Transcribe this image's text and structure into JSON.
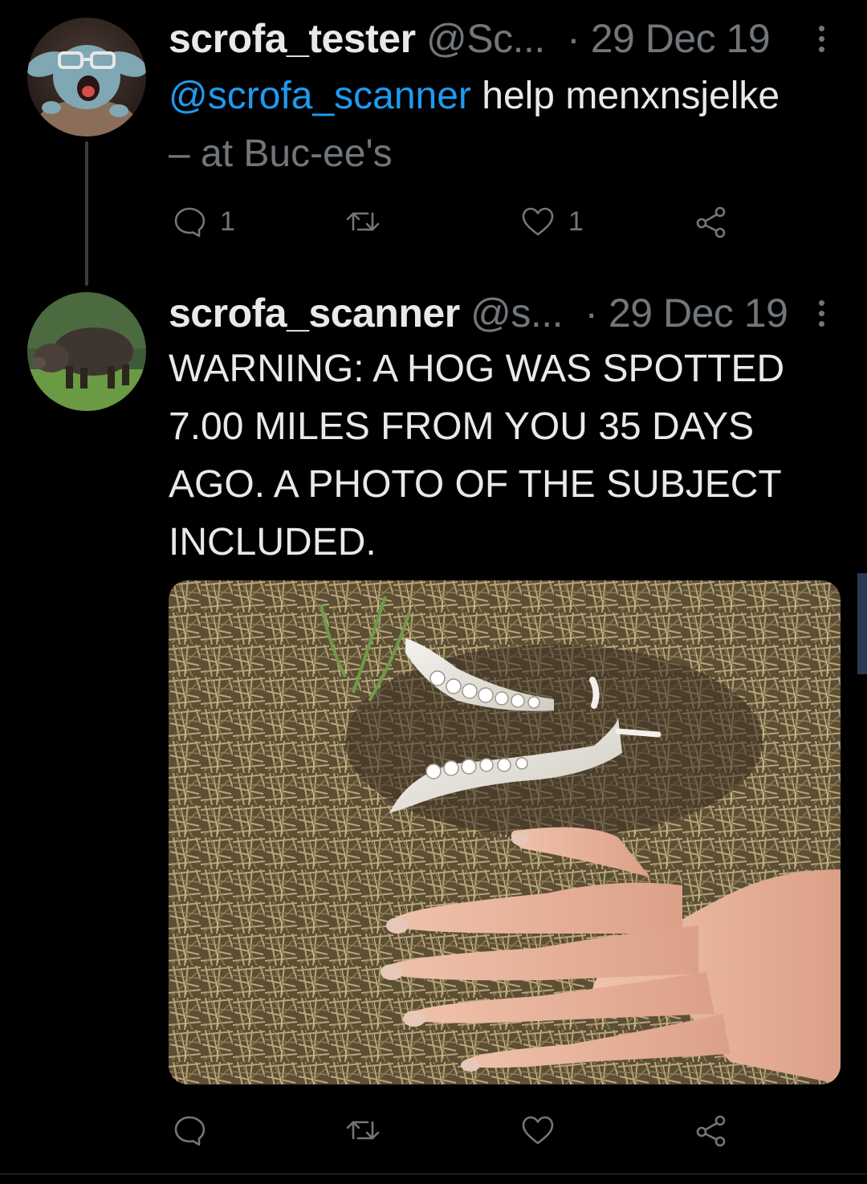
{
  "tweets": [
    {
      "display_name": "scrofa_tester",
      "handle": "@Sc...",
      "date": "· 29 Dec 19",
      "text_mention": "@scrofa_scanner",
      "text_main": " help menxnsjelke",
      "text_line2": "– at Buc-ee's",
      "reply_count": "1",
      "retweet_count": "",
      "like_count": "1",
      "avatar_icon": "baby-yoda-avatar"
    },
    {
      "display_name": "scrofa_scanner",
      "handle": "@s...",
      "date": "· 29 Dec 19",
      "text_line1": "WARNING: A HOG WAS SPOTTED",
      "text_line2": "7.00 MILES FROM YOU 35 DAYS",
      "text_line3": "AGO.  A PHOTO OF THE SUBJECT",
      "text_line4": "INCLUDED.",
      "reply_count": "",
      "retweet_count": "",
      "like_count": "",
      "avatar_icon": "wild-boar-avatar",
      "media_icon": "hog-jawbone-and-hand-photo"
    }
  ],
  "icons": [
    "reply-icon",
    "retweet-icon",
    "like-icon",
    "share-icon",
    "more-icon"
  ],
  "colors": {
    "background": "#000000",
    "text": "#e7e9ea",
    "muted": "#71767b",
    "link": "#1d9bf0"
  }
}
